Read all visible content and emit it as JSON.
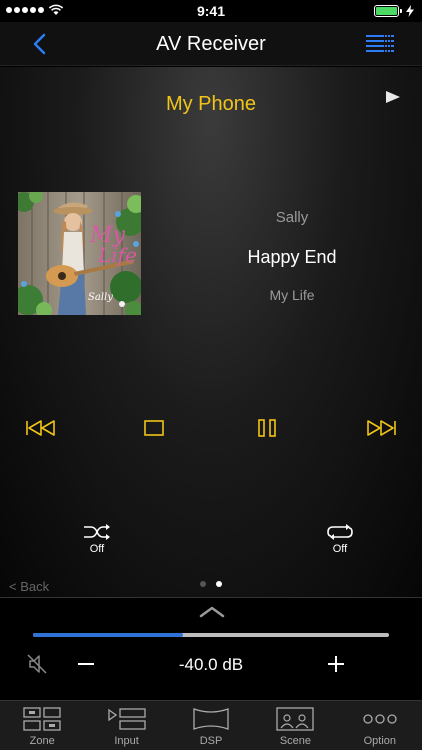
{
  "status_bar": {
    "time": "9:41"
  },
  "nav": {
    "title": "AV Receiver"
  },
  "source": {
    "name": "My Phone"
  },
  "track": {
    "artist": "Sally",
    "title": "Happy End",
    "album": "My Life"
  },
  "album_art": {
    "overlay_title_line1": "My",
    "overlay_title_line2": "Life",
    "overlay_artist": "Sally"
  },
  "modes": {
    "shuffle_label": "Off",
    "repeat_label": "Off"
  },
  "page": {
    "back_label": "< Back",
    "total": 2,
    "current": 2
  },
  "volume": {
    "value": "-40.0 dB",
    "level_fraction": 0.42
  },
  "tabs": [
    {
      "label": "Zone",
      "icon": "zone-icon"
    },
    {
      "label": "Input",
      "icon": "input-icon"
    },
    {
      "label": "DSP",
      "icon": "dsp-icon"
    },
    {
      "label": "Scene",
      "icon": "scene-icon"
    },
    {
      "label": "Option",
      "icon": "option-icon"
    }
  ],
  "colors": {
    "accent_yellow": "#f0c419",
    "accent_blue": "#2f73d8",
    "nav_blue": "#2d7cf6",
    "battery_green": "#4cd964"
  }
}
